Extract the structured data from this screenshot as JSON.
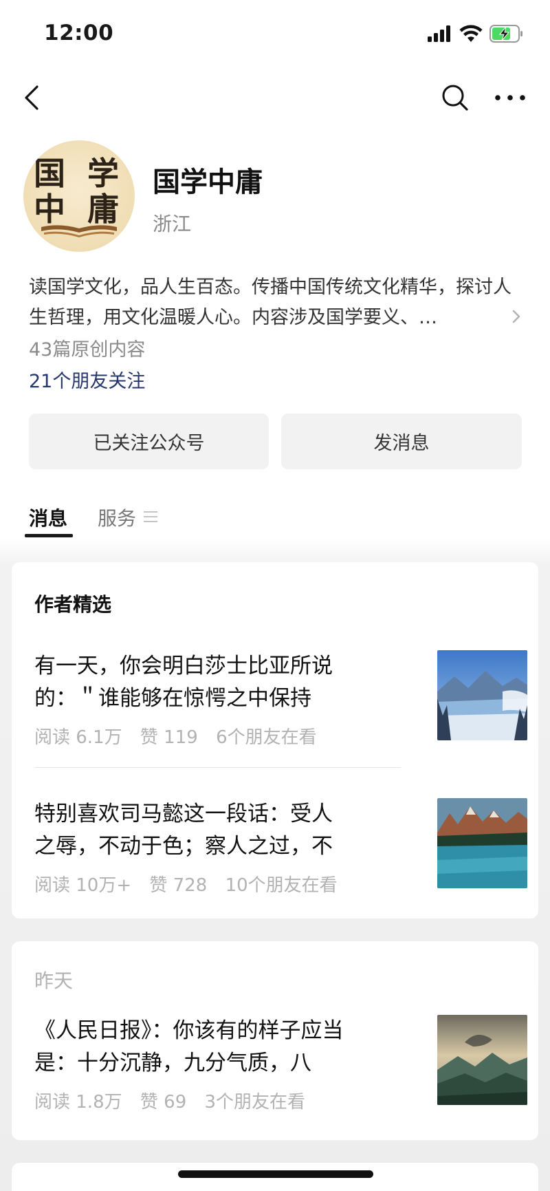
{
  "status_bar": {
    "time": "12:00"
  },
  "account": {
    "name": "国学中庸",
    "region": "浙江",
    "avatar_text_top": "国 学",
    "avatar_text_bottom": "中 庸",
    "description": "读国学文化，品人生百态。传播中国传统文化精华，探讨人生哲理，用文化温暖人心。内容涉及国学要义、…",
    "original_count": "43篇原创内容",
    "friends_following": "21个朋友关注"
  },
  "buttons": {
    "followed": "已关注公众号",
    "send_message": "发消息"
  },
  "tabs": {
    "messages": "消息",
    "services": "服务"
  },
  "featured": {
    "title": "作者精选",
    "articles": [
      {
        "title": "有一天，你会明白莎士比亚所说的：＂谁能够在惊愕之中保持冷…",
        "reads": "阅读 6.1万",
        "likes": "赞 119",
        "friends": "6个朋友在看"
      },
      {
        "title": "特别喜欢司马懿这一段话：受人之辱，不动于色；察人之过，不扬…",
        "reads": "阅读 10万+",
        "likes": "赞 728",
        "friends": "10个朋友在看"
      }
    ]
  },
  "yesterday": {
    "date": "昨天",
    "articles": [
      {
        "title": "《人民日报》：你该有的样子应当是：十分沉静，九分气质，八分…",
        "reads": "阅读 1.8万",
        "likes": "赞 69",
        "friends": "3个朋友在看"
      }
    ]
  },
  "icons": {
    "back": "chevron-left-icon",
    "search": "search-icon",
    "more": "more-dots-icon",
    "service_menu": "menu-lines-icon"
  }
}
